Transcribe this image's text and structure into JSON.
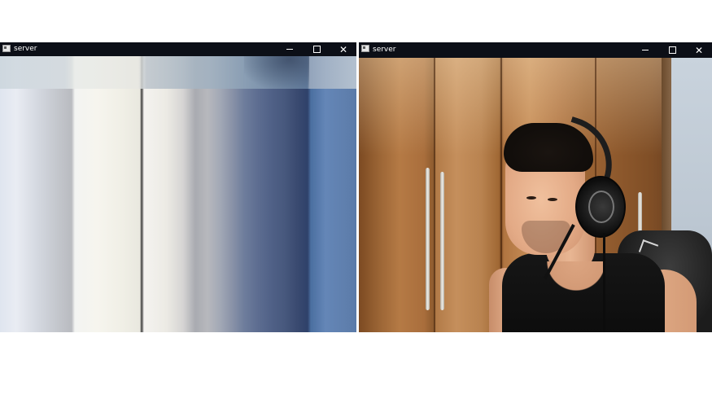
{
  "windows": [
    {
      "title": "server",
      "controls": {
        "minimize": "minimize-icon",
        "maximize": "maximize-icon",
        "close": "close-icon"
      }
    },
    {
      "title": "server",
      "controls": {
        "minimize": "minimize-icon",
        "maximize": "maximize-icon",
        "close": "close-icon"
      }
    }
  ],
  "colors": {
    "titlebar": "#0c0f17",
    "title_text": "#ffffff",
    "page_background": "#ffffff"
  }
}
